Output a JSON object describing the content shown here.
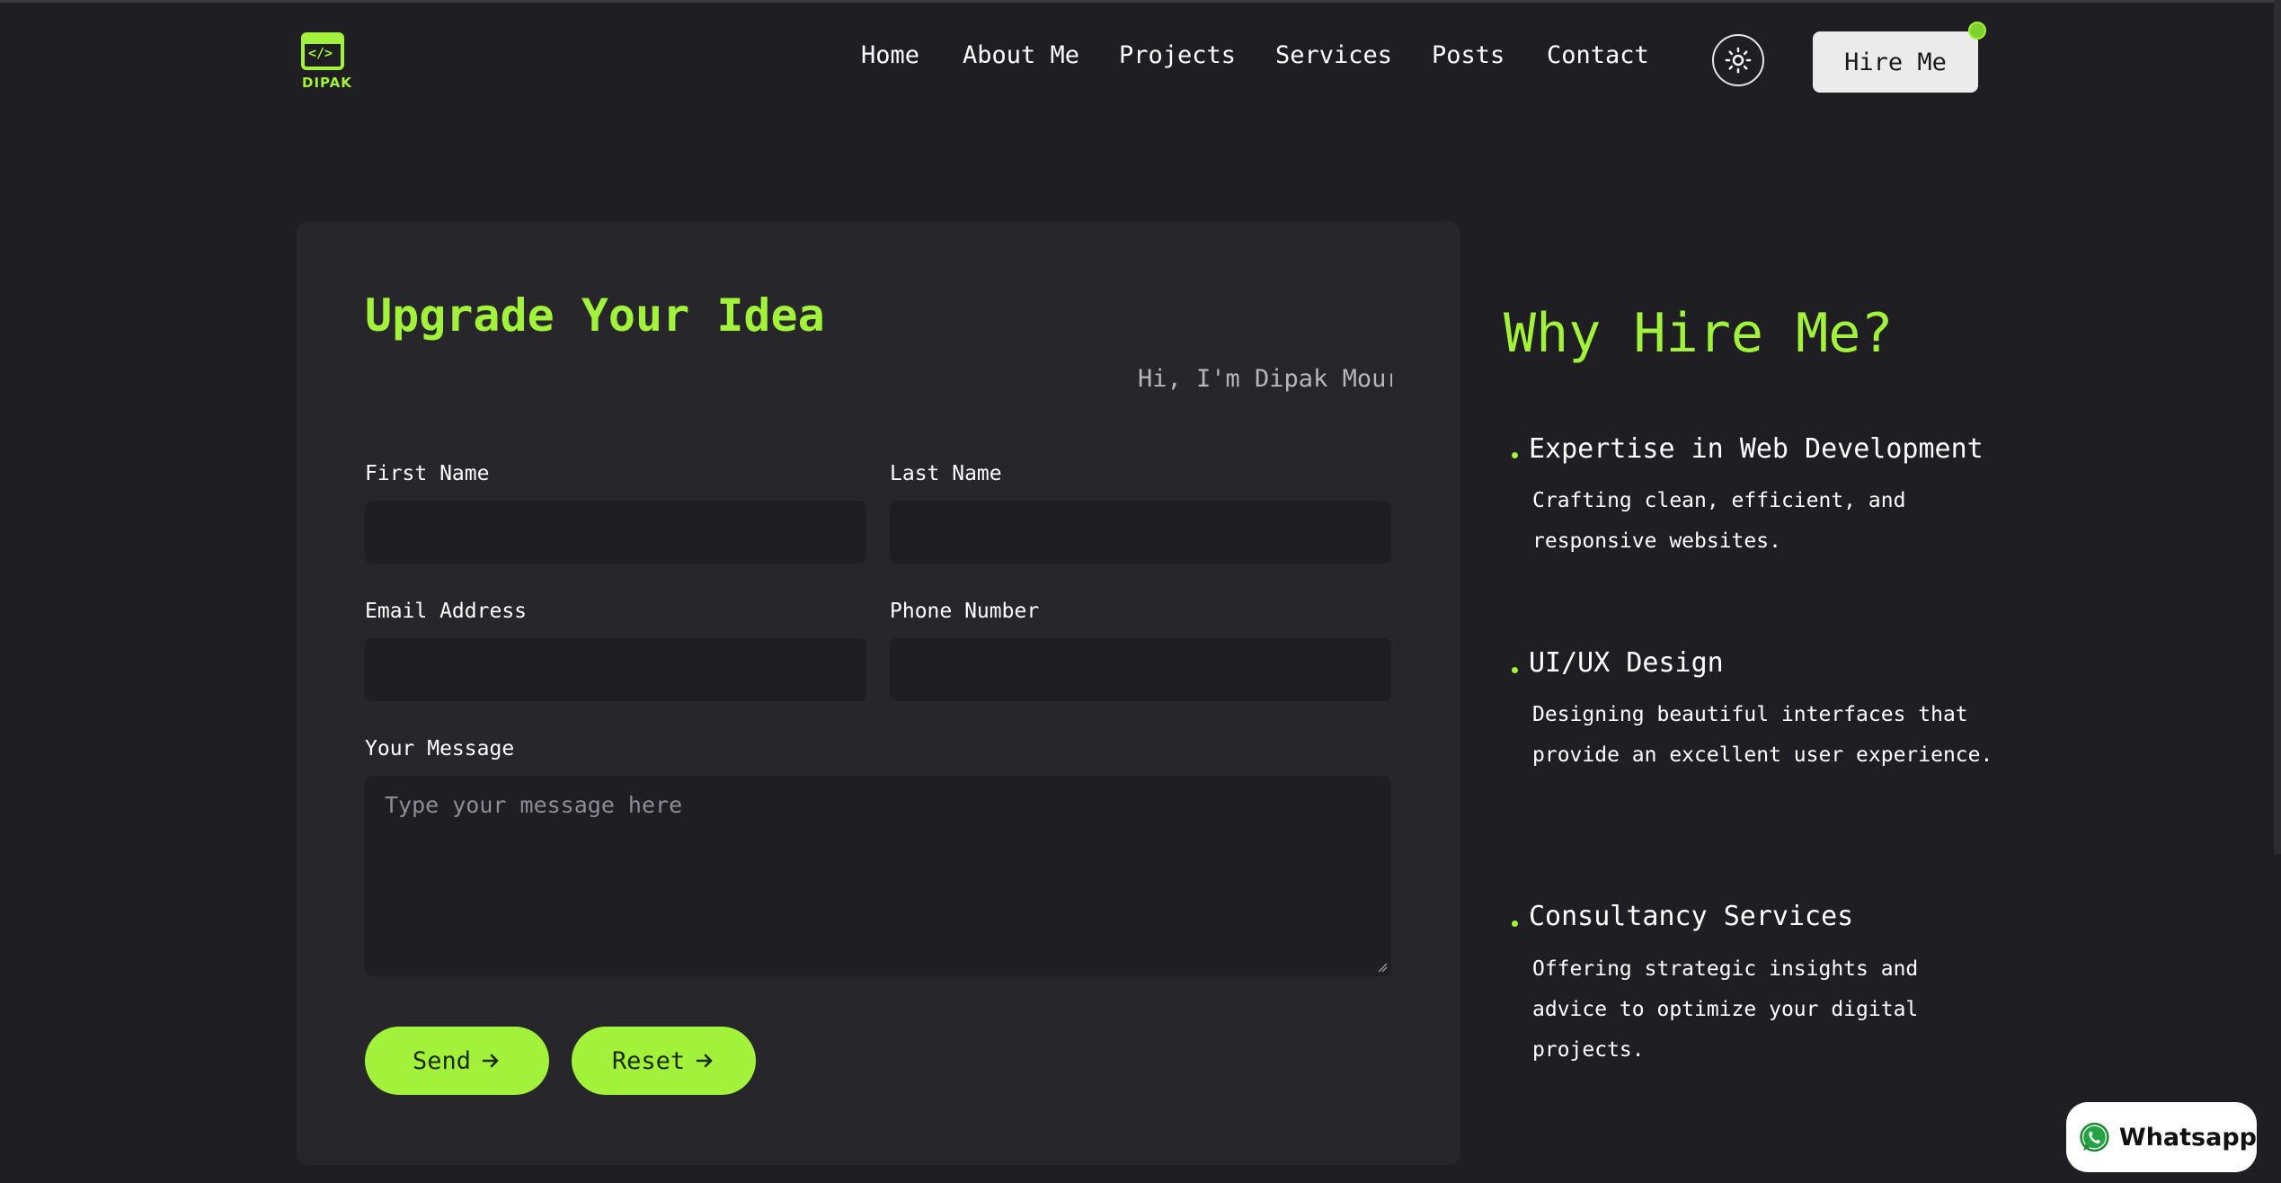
{
  "header": {
    "logo_text": "DIPAK",
    "logo_code": "</>",
    "nav": [
      "Home",
      "About Me",
      "Projects",
      "Services",
      "Posts",
      "Contact"
    ],
    "theme_icon": "sun-icon",
    "hire_label": "Hire Me"
  },
  "form": {
    "title": "Upgrade Your Idea",
    "typing_text": "Hi, I'm Dipak Mourya",
    "first_name_label": "First Name",
    "last_name_label": "Last Name",
    "email_label": "Email Address",
    "phone_label": "Phone Number",
    "message_label": "Your Message",
    "first_name_value": "",
    "last_name_value": "",
    "email_value": "",
    "phone_value": "",
    "message_placeholder": "Type your message here",
    "send_label": "Send",
    "reset_label": "Reset"
  },
  "why": {
    "title": "Why Hire Me?",
    "items": [
      {
        "title": "Expertise in Web Development",
        "desc": "Crafting clean, efficient, and responsive websites."
      },
      {
        "title": "UI/UX Design",
        "desc": "Designing beautiful interfaces that provide an excellent user experience."
      },
      {
        "title": "Consultancy Services",
        "desc": "Offering strategic insights and advice to optimize your digital projects."
      }
    ]
  },
  "whatsapp": {
    "label": "Whatsapp",
    "icon": "whatsapp-icon"
  },
  "colors": {
    "accent": "#a2f13a",
    "background": "#1e1e23",
    "card": "#27272b"
  }
}
